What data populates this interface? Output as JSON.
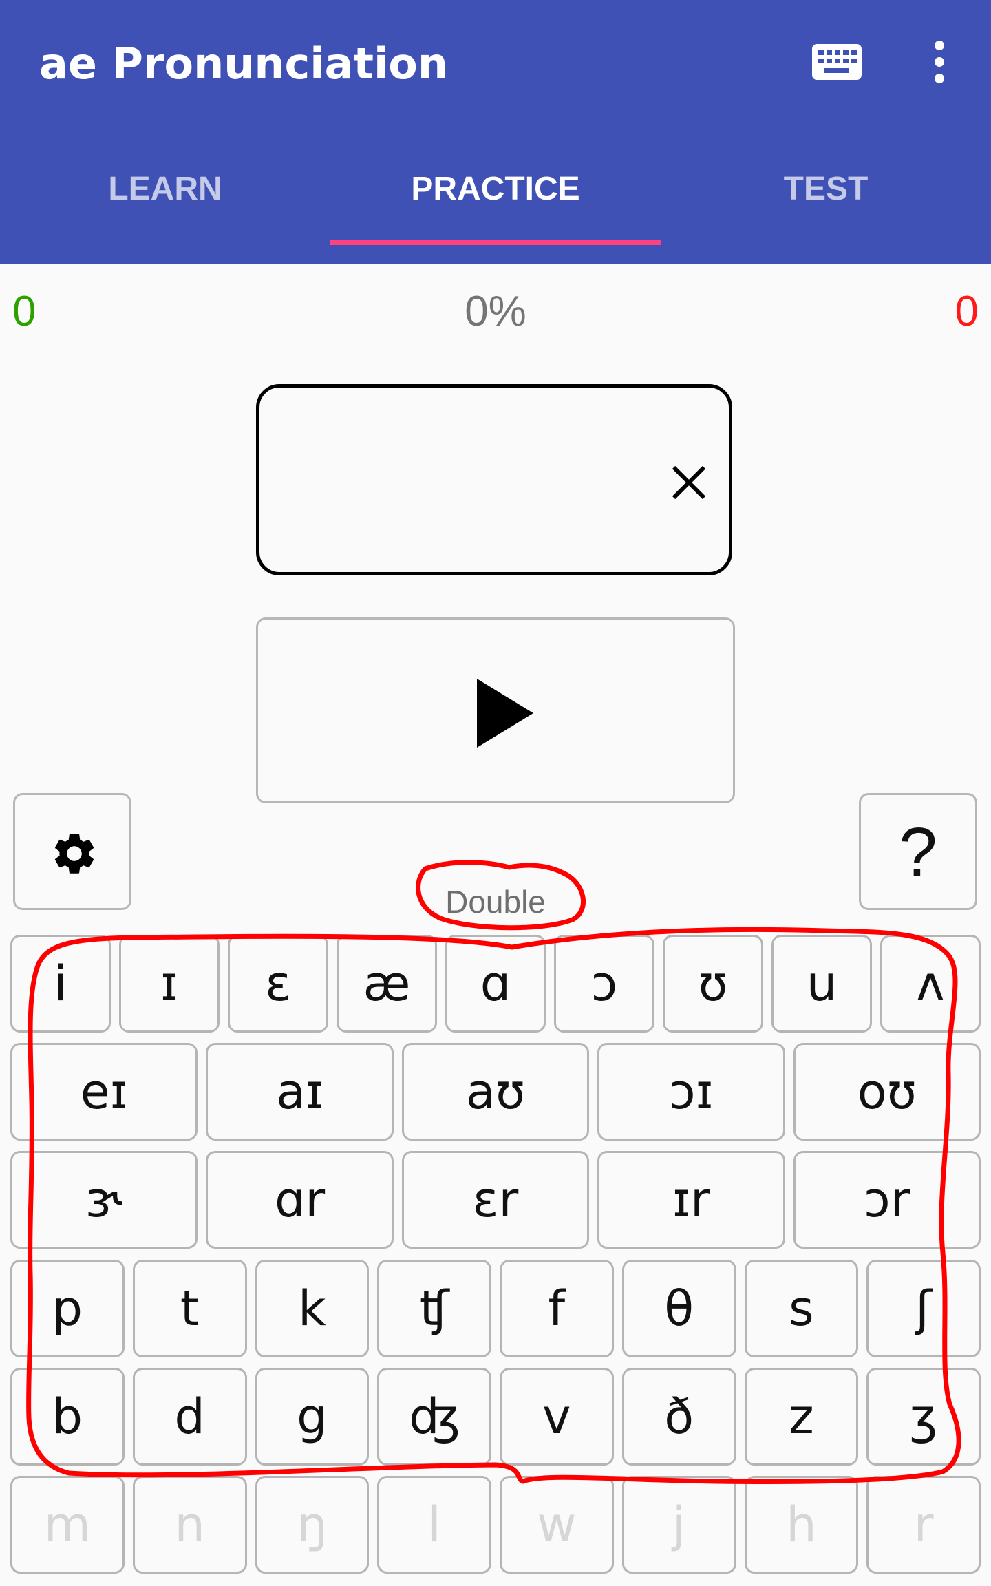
{
  "app_bar": {
    "title": "ae Pronunciation",
    "background_color": "#3f51b5",
    "actions": [
      {
        "icon": "keyboard-icon"
      },
      {
        "icon": "more-vert-icon"
      }
    ]
  },
  "tabs": [
    {
      "label": "LEARN",
      "active": false
    },
    {
      "label": "PRACTICE",
      "active": true
    },
    {
      "label": "TEST",
      "active": false
    }
  ],
  "tab_indicator_color": "#ff4081",
  "score": {
    "correct": "0",
    "percent": "0%",
    "wrong": "0",
    "correct_color": "#2ea000",
    "wrong_color": "#ff1a1a"
  },
  "answer_box": {
    "value": "",
    "clear_icon": "close-icon"
  },
  "play_button": {
    "icon": "play-icon"
  },
  "settings_button": {
    "icon": "gear-icon"
  },
  "help_button": {
    "label": "?"
  },
  "mode_label": "Double",
  "keyboard": {
    "rows": [
      [
        "i",
        "ɪ",
        "ɛ",
        "æ",
        "ɑ",
        "ɔ",
        "ʊ",
        "u",
        "ʌ"
      ],
      [
        "eɪ",
        "aɪ",
        "aʊ",
        "ɔɪ",
        "oʊ"
      ],
      [
        "ɝ",
        "ɑr",
        "ɛr",
        "ɪr",
        "ɔr"
      ],
      [
        "p",
        "t",
        "k",
        "ʧ",
        "f",
        "θ",
        "s",
        "ʃ"
      ],
      [
        "b",
        "d",
        "g",
        "ʤ",
        "v",
        "ð",
        "z",
        "ʒ"
      ],
      [
        "m",
        "n",
        "ŋ",
        "l",
        "w",
        "j",
        "h",
        "r"
      ]
    ],
    "disabled_row": 5
  },
  "annotation_color": "#ff0000"
}
